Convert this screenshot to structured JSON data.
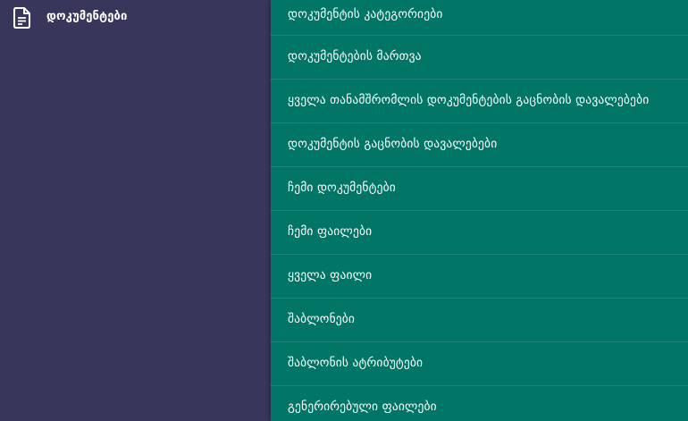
{
  "sidebar": {
    "documents": {
      "icon": "document-icon",
      "label": "დოკუმენტები"
    }
  },
  "submenu": {
    "items": [
      {
        "label": "დოკუმენტის კატეგორიები"
      },
      {
        "label": "დოკუმენტების მართვა"
      },
      {
        "label": "ყველა თანამშრომლის დოკუმენტების გაცნობის დავალებები"
      },
      {
        "label": "დოკუმენტის გაცნობის დავალებები"
      },
      {
        "label": "ჩემი დოკუმენტები"
      },
      {
        "label": "ჩემი ფაილები"
      },
      {
        "label": "ყველა ფაილი"
      },
      {
        "label": "შაბლონები"
      },
      {
        "label": "შაბლონის ატრიბუტები"
      },
      {
        "label": "გენერირებული ფაილები"
      }
    ]
  },
  "colors": {
    "sidebar_bg": "#38365a",
    "submenu_bg": "#017566",
    "text": "#ffffff"
  }
}
